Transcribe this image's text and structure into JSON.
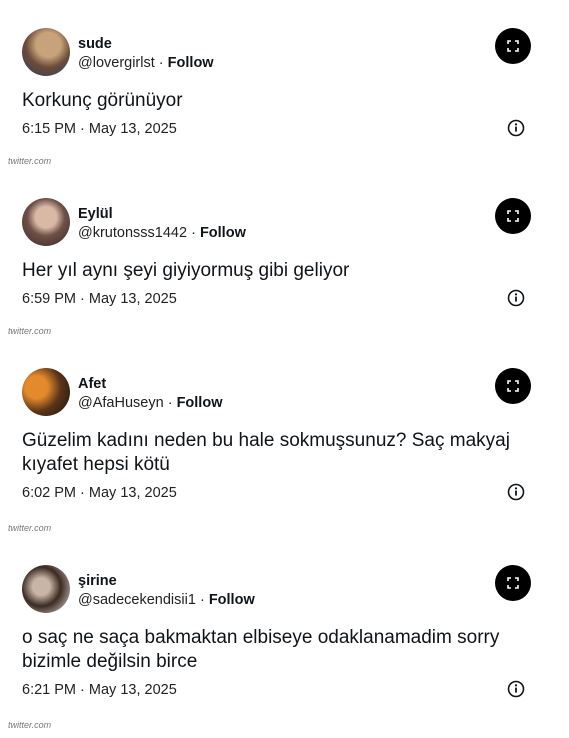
{
  "tweets": [
    {
      "name": "sude",
      "handle": "@lovergirlst",
      "separator": "·",
      "follow": "Follow",
      "text": "Korkunç görünüyor",
      "time": "6:15 PM",
      "date": "May 13, 2025",
      "source": "twitter.com",
      "avatar_colors": [
        "#6b4b3a",
        "#c7a27a",
        "#2f3d5c"
      ]
    },
    {
      "name": "Eylül",
      "handle": "@krutonsss1442",
      "separator": "·",
      "follow": "Follow",
      "text": "Her yıl aynı şeyi giyiyormuş gibi geliyor",
      "time": "6:59 PM",
      "date": "May 13, 2025",
      "source": "twitter.com",
      "avatar_colors": [
        "#3a2a24",
        "#d9b8a6",
        "#6e5048"
      ]
    },
    {
      "name": "Afet",
      "handle": "@AfaHuseyn",
      "separator": "·",
      "follow": "Follow",
      "text": "Güzelim kadını neden bu hale sokmuşsunuz? Saç makyaj kıyafet hepsi kötü",
      "time": "6:02 PM",
      "date": "May 13, 2025",
      "source": "twitter.com",
      "avatar_colors": [
        "#1b1410",
        "#e58a2c",
        "#5a3418"
      ]
    },
    {
      "name": "şirine",
      "handle": "@sadecekendisii1",
      "separator": "·",
      "follow": "Follow",
      "text": "o saç ne saça bakmaktan elbiseye odaklanamadim sorry bizimle değilsin birce",
      "time": "6:21 PM",
      "date": "May 13, 2025",
      "source": "twitter.com",
      "avatar_colors": [
        "#e9e4df",
        "#3b2a22",
        "#c8b5a6"
      ]
    }
  ]
}
